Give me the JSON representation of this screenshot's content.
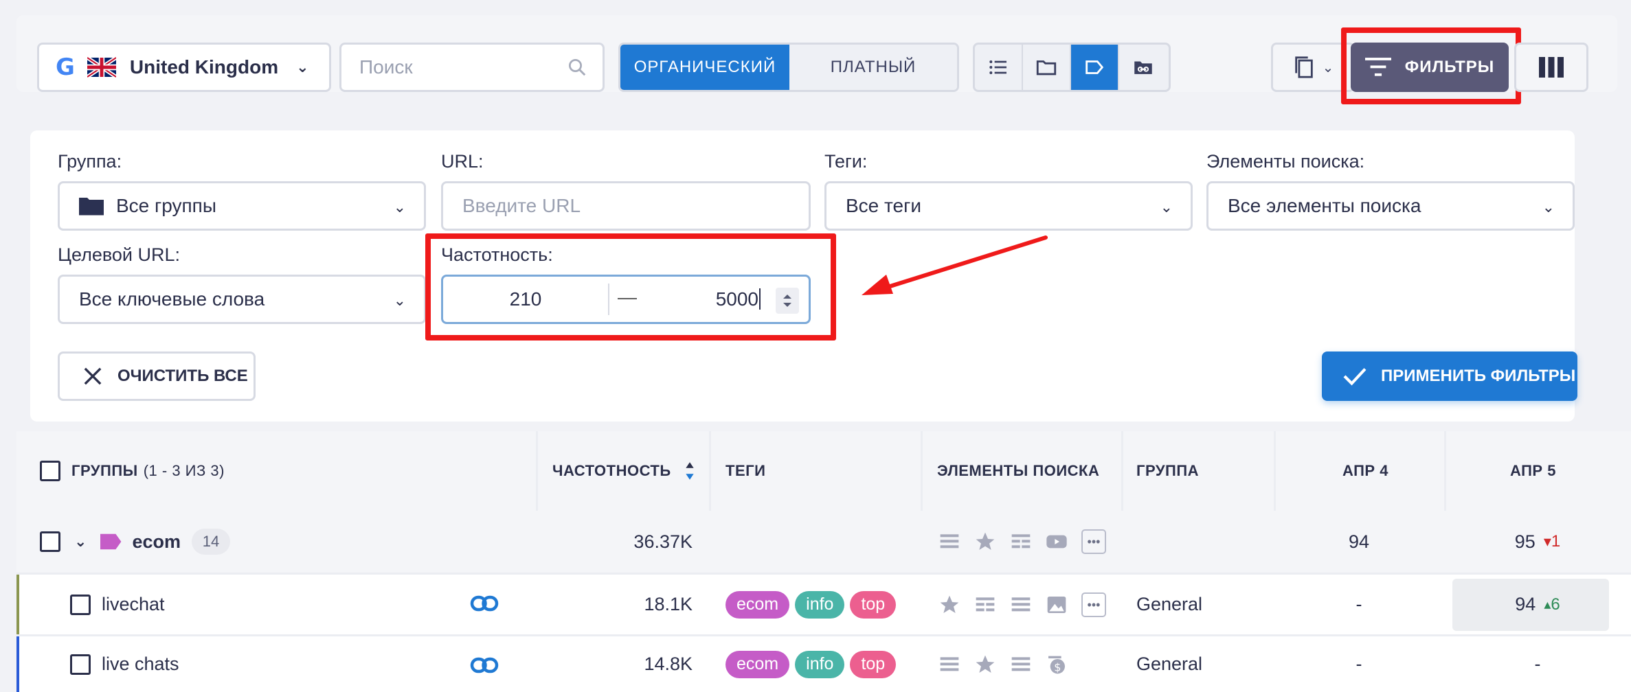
{
  "toolbar": {
    "country": "United Kingdom",
    "search_placeholder": "Поиск",
    "tabs": [
      "ОРГАНИЧЕСКИЙ",
      "ПЛАТНЫЙ"
    ],
    "filters_label": "ФИЛЬТРЫ"
  },
  "filters": {
    "group_label": "Группа:",
    "group_value": "Все группы",
    "url_label": "URL:",
    "url_placeholder": "Введите URL",
    "tags_label": "Теги:",
    "tags_value": "Все теги",
    "serp_label": "Элементы поиска:",
    "serp_value": "Все элементы поиска",
    "target_label": "Целевой URL:",
    "target_value": "Все ключевые слова",
    "freq_label": "Частотность:",
    "freq_min": "210",
    "freq_dash": "—",
    "freq_max": "5000",
    "clear_label": "ОЧИСТИТЬ ВСЕ",
    "apply_label": "ПРИМЕНИТЬ ФИЛЬТРЫ"
  },
  "table": {
    "headers": {
      "groups": "ГРУППЫ",
      "groups_count": "(1 - 3 ИЗ 3)",
      "freq": "ЧАСТОТНОСТЬ",
      "tags": "ТЕГИ",
      "serp": "ЭЛЕМЕНТЫ ПОИСКА",
      "group": "ГРУППА",
      "apr4": "АПР 4",
      "apr5": "АПР 5"
    },
    "rows": [
      {
        "name": "ecom",
        "count": "14",
        "freq": "36.37K",
        "group": "",
        "apr4": "94",
        "apr5": "95",
        "apr5_delta": "1"
      },
      {
        "name": "livechat",
        "freq": "18.1K",
        "tags": [
          "ecom",
          "info",
          "top"
        ],
        "group": "General",
        "apr4": "-",
        "apr5": "94",
        "apr5_delta": "6"
      },
      {
        "name": "live chats",
        "freq": "14.8K",
        "tags": [
          "ecom",
          "info",
          "top"
        ],
        "group": "General",
        "apr4": "-",
        "apr5": "-"
      }
    ]
  },
  "colors": {
    "accent": "#1f79d3",
    "highlight": "#ef1a1a",
    "filters_button": "#5a5978"
  }
}
